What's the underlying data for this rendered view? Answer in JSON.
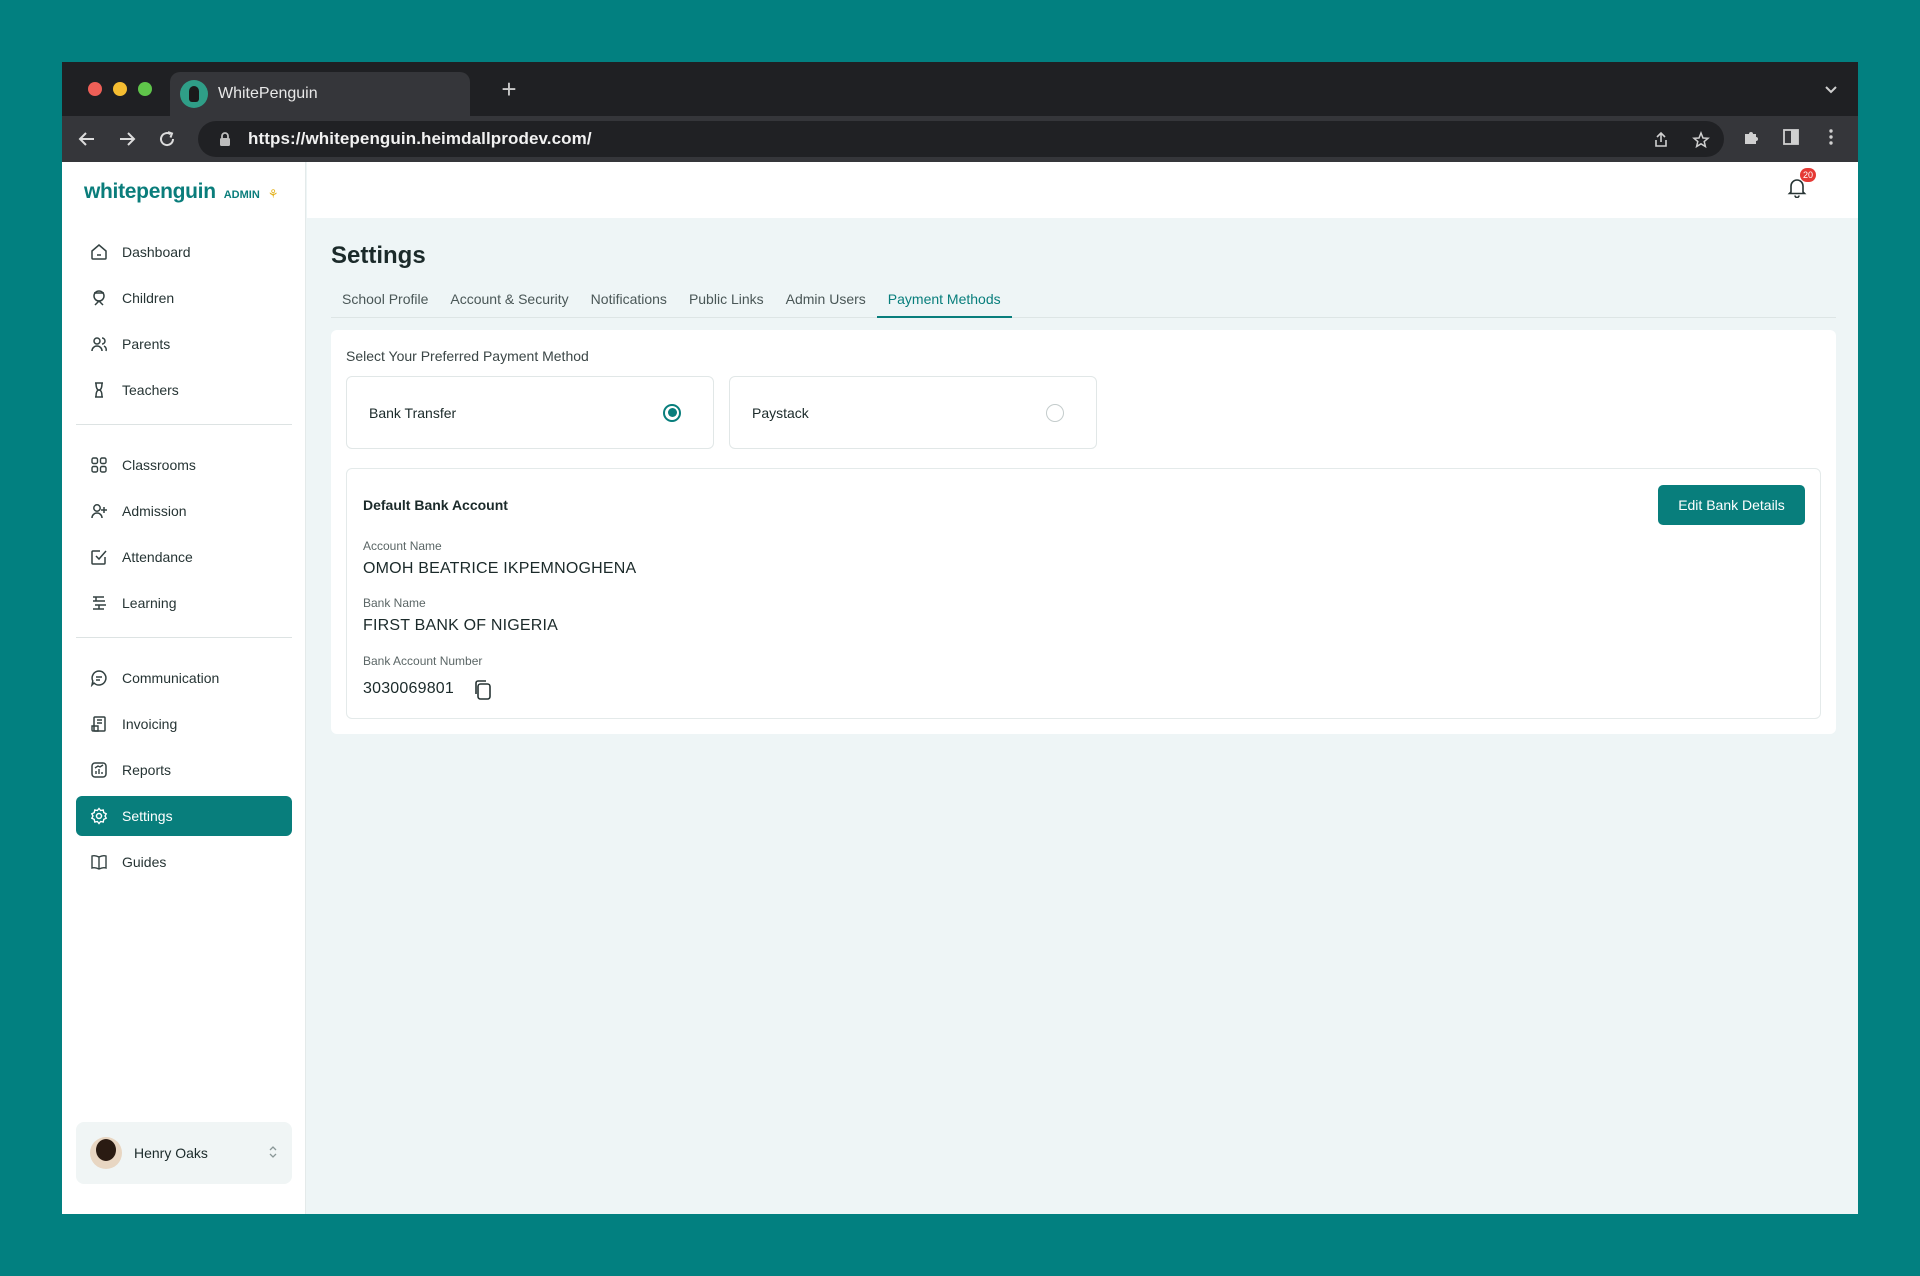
{
  "browser": {
    "tab_title": "WhitePenguin",
    "url": "https://whitepenguin.heimdallprodev.com/"
  },
  "brand": {
    "logo_text": "whitepenguin",
    "badge": "ADMIN"
  },
  "sidebar": {
    "group1": [
      {
        "label": "Dashboard",
        "icon": "home-icon"
      },
      {
        "label": "Children",
        "icon": "child-icon"
      },
      {
        "label": "Parents",
        "icon": "users-icon"
      },
      {
        "label": "Teachers",
        "icon": "teacher-icon"
      }
    ],
    "group2": [
      {
        "label": "Classrooms",
        "icon": "grid-icon"
      },
      {
        "label": "Admission",
        "icon": "user-add-icon"
      },
      {
        "label": "Attendance",
        "icon": "check-square-icon"
      },
      {
        "label": "Learning",
        "icon": "book-stack-icon"
      }
    ],
    "group3": [
      {
        "label": "Communication",
        "icon": "chat-icon"
      },
      {
        "label": "Invoicing",
        "icon": "receipt-icon"
      },
      {
        "label": "Reports",
        "icon": "chart-icon"
      },
      {
        "label": "Settings",
        "icon": "gear-icon",
        "active": true
      },
      {
        "label": "Guides",
        "icon": "open-book-icon"
      }
    ]
  },
  "user": {
    "name": "Henry Oaks"
  },
  "notifications": {
    "count": "20"
  },
  "page": {
    "title": "Settings",
    "tabs": [
      "School Profile",
      "Account & Security",
      "Notifications",
      "Public Links",
      "Admin Users",
      "Payment Methods"
    ],
    "active_tab": "Payment Methods"
  },
  "payment": {
    "section_label": "Select Your Preferred Payment Method",
    "options": [
      {
        "label": "Bank Transfer",
        "selected": true
      },
      {
        "label": "Paystack",
        "selected": false
      }
    ]
  },
  "bank": {
    "heading": "Default Bank Account",
    "edit_label": "Edit Bank Details",
    "account_name_label": "Account Name",
    "account_name": "OMOH BEATRICE IKPEMNOGHENA",
    "bank_name_label": "Bank Name",
    "bank_name": "FIRST BANK OF NIGERIA",
    "account_number_label": "Bank Account Number",
    "account_number": "3030069801"
  },
  "colors": {
    "accent": "#087e7c",
    "background": "#028080",
    "badge": "#e53935"
  }
}
